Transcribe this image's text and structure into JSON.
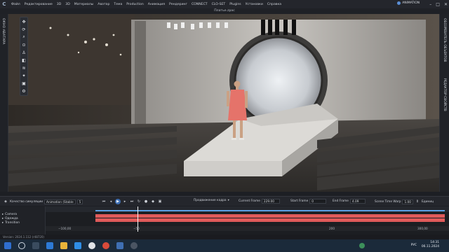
{
  "app": {
    "logo": "C",
    "menu": [
      "Файл",
      "Редактирование",
      "3D",
      "3D",
      "Материалы",
      "Аватар",
      "Тема",
      "Production",
      "Анимация",
      "Рендеринг",
      "CONNECT",
      "CLO-SET",
      "Plugins",
      "Установки",
      "Справка"
    ],
    "mode_label": "ANIMATION",
    "window_controls": [
      "–",
      "□",
      "✕"
    ]
  },
  "document": {
    "title": "Платье.zpac"
  },
  "left_tab": {
    "label": "ОКНО АВАТАРА"
  },
  "right_tabs": [
    "ОБОЗРЕВАТЕЛЬ ОБЪЕКТОВ",
    "РЕДАКТОР СВОЙСТВ"
  ],
  "toolbox": {
    "icons": [
      "move-icon",
      "rotate-icon",
      "zoom-icon",
      "pin-icon",
      "avatar-icon",
      "fold-icon",
      "wind-icon",
      "light-icon",
      "camera-icon",
      "settings-icon"
    ]
  },
  "animation_toolbar": {
    "sim_quality_label": "Качество симуляции",
    "sim_quality_value": "Animation (Stable",
    "frame_step_value": "5",
    "playback_mode_label": "Продвижение кадра",
    "current_frame_label": "Current Frame",
    "current_frame_value": "229.00",
    "start_frame_label": "Start Frame",
    "start_frame_value": "0",
    "end_frame_label": "End Frame",
    "end_frame_value": "4.09",
    "time_warp_label": "Scene Time Warp",
    "time_warp_value": "1.00",
    "units_label": "Единиц"
  },
  "timeline": {
    "tracks": [
      "Camera",
      "Одежда",
      "Transition"
    ],
    "ruler_labels": [
      "−100,00",
      "−50",
      "200",
      "300,00"
    ],
    "playhead_fraction": 0.12,
    "footer_text": "Version: 2024.1.112 (r48720)"
  },
  "taskbar": {
    "language": "РУС",
    "time": "14:31",
    "date": "06.11.2024"
  },
  "colors": {
    "accent": "#3f6fb3",
    "timeline_red": "#e05a5a",
    "timeline_blue": "#5aa0e6"
  }
}
